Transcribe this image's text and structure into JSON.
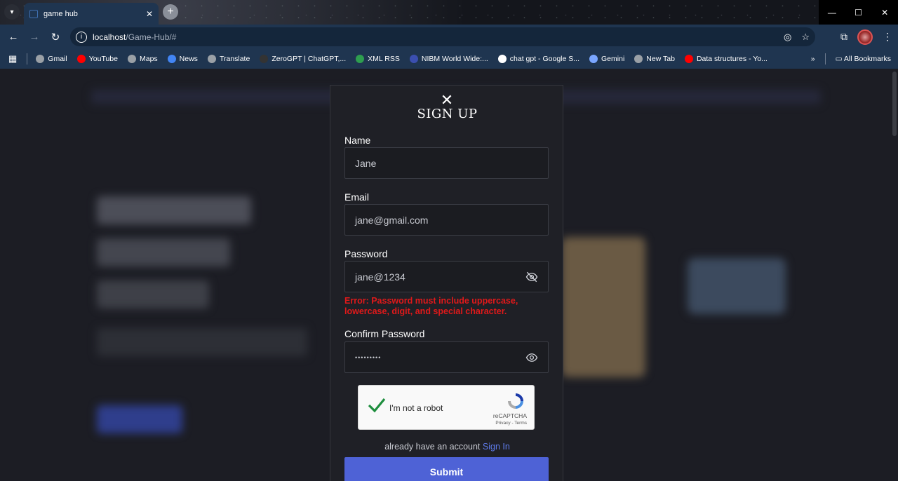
{
  "browser": {
    "tab_title": "game hub",
    "url_host": "localhost",
    "url_path": "/Game-Hub/#",
    "bookmarks": [
      {
        "label": "Gmail",
        "color": "#9aa0a6"
      },
      {
        "label": "YouTube",
        "color": "#ff0000"
      },
      {
        "label": "Maps",
        "color": "#9aa0a6"
      },
      {
        "label": "News",
        "color": "#4285f4"
      },
      {
        "label": "Translate",
        "color": "#9aa0a6"
      },
      {
        "label": "ZeroGPT | ChatGPT,...",
        "color": "#333333"
      },
      {
        "label": "XML RSS",
        "color": "#2e9e4f"
      },
      {
        "label": "NIBM World Wide:...",
        "color": "#3b4fb0"
      },
      {
        "label": "chat gpt - Google S...",
        "color": "#ffffff"
      },
      {
        "label": "Gemini",
        "color": "#7aa6ff"
      },
      {
        "label": "New Tab",
        "color": "#9aa0a6"
      },
      {
        "label": "Data structures - Yo...",
        "color": "#ff0000"
      }
    ],
    "all_bookmarks": "All Bookmarks"
  },
  "modal": {
    "title": "SIGN UP",
    "name_label": "Name",
    "name_value": "Jane",
    "email_label": "Email",
    "email_value": "jane@gmail.com",
    "password_label": "Password",
    "password_value": "jane@1234",
    "password_error": "Error: Password must include uppercase, lowercase, digit, and special character.",
    "confirm_label": "Confirm Password",
    "confirm_value": "•••••••••",
    "recaptcha_label": "I'm not a robot",
    "recaptcha_brand": "reCAPTCHA",
    "recaptcha_terms": "Privacy - Terms",
    "signin_prompt": "already have an account",
    "signin_link": "Sign In",
    "submit_label": "Submit"
  },
  "colors": {
    "accent": "#4e62d6",
    "error": "#e0191a",
    "link": "#5d7ae8"
  }
}
